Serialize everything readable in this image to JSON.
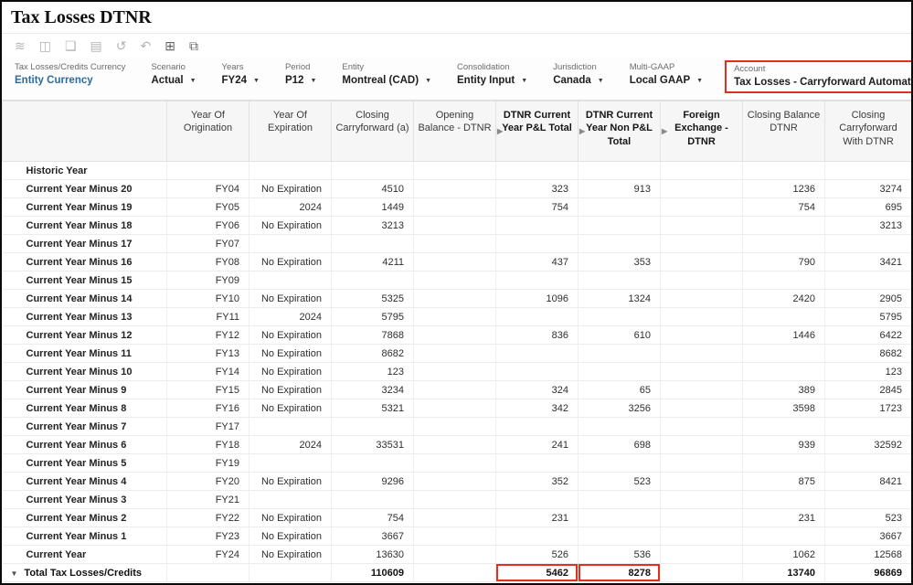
{
  "colors": {
    "accent_red": "#e0301e",
    "link_blue": "#2b6b9e"
  },
  "page": {
    "title": "Tax Losses DTNR"
  },
  "toolbar": {
    "icons": [
      {
        "name": "format-grid-icon",
        "glyph": "≋",
        "dim": true
      },
      {
        "name": "freeze-pane-icon",
        "glyph": "◫",
        "dim": true
      },
      {
        "name": "comment-icon",
        "glyph": "❑",
        "dim": true
      },
      {
        "name": "hierarchy-icon",
        "glyph": "▤",
        "dim": true
      },
      {
        "name": "history-icon",
        "glyph": "↺",
        "dim": true
      },
      {
        "name": "undo-icon",
        "glyph": "↶",
        "dim": true
      },
      {
        "name": "expand-grid-icon",
        "glyph": "⊞",
        "dim": false
      },
      {
        "name": "open-window-icon",
        "glyph": "⧉",
        "dim": false
      }
    ]
  },
  "pov": {
    "items": [
      {
        "label": "Tax Losses/Credits Currency",
        "value": "Entity Currency",
        "dropdown": false,
        "blue": true,
        "highlighted": false
      },
      {
        "label": "Scenario",
        "value": "Actual",
        "dropdown": true,
        "blue": false,
        "highlighted": false
      },
      {
        "label": "Years",
        "value": "FY24",
        "dropdown": true,
        "blue": false,
        "highlighted": false
      },
      {
        "label": "Period",
        "value": "P12",
        "dropdown": true,
        "blue": false,
        "highlighted": false
      },
      {
        "label": "Entity",
        "value": "Montreal (CAD)",
        "dropdown": true,
        "blue": false,
        "highlighted": false
      },
      {
        "label": "Consolidation",
        "value": "Entity Input",
        "dropdown": true,
        "blue": false,
        "highlighted": false
      },
      {
        "label": "Jurisdiction",
        "value": "Canada",
        "dropdown": true,
        "blue": false,
        "highlighted": false
      },
      {
        "label": "Multi-GAAP",
        "value": "Local GAAP",
        "dropdown": true,
        "blue": false,
        "highlighted": false
      },
      {
        "label": "Account",
        "value": "Tax Losses - Carryforward Automated",
        "dropdown": false,
        "blue": false,
        "highlighted": true
      }
    ]
  },
  "table": {
    "columns": [
      {
        "label": "",
        "bold": false,
        "arrow": false
      },
      {
        "label": "Year Of Origination",
        "bold": false,
        "arrow": false
      },
      {
        "label": "Year Of Expiration",
        "bold": false,
        "arrow": false
      },
      {
        "label": "Closing Carryforward (a)",
        "bold": false,
        "arrow": false
      },
      {
        "label": "Opening Balance - DTNR",
        "bold": false,
        "arrow": false
      },
      {
        "label": "DTNR Current Year P&L Total",
        "bold": true,
        "arrow": true
      },
      {
        "label": "DTNR Current Year Non P&L Total",
        "bold": true,
        "arrow": true
      },
      {
        "label": "Foreign Exchange - DTNR",
        "bold": true,
        "arrow": true
      },
      {
        "label": "Closing Balance DTNR",
        "bold": false,
        "arrow": false
      },
      {
        "label": "Closing Carryforward With DTNR",
        "bold": false,
        "arrow": false
      }
    ],
    "rows": [
      {
        "label": "Historic Year",
        "cells": [
          "",
          "",
          "",
          "",
          "",
          "",
          "",
          "",
          ""
        ]
      },
      {
        "label": "Current Year Minus 20",
        "cells": [
          "FY04",
          "No Expiration",
          "4510",
          "",
          "323",
          "913",
          "",
          "1236",
          "3274"
        ]
      },
      {
        "label": "Current Year Minus 19",
        "cells": [
          "FY05",
          "2024",
          "1449",
          "",
          "754",
          "",
          "",
          "754",
          "695"
        ]
      },
      {
        "label": "Current Year Minus 18",
        "cells": [
          "FY06",
          "No Expiration",
          "3213",
          "",
          "",
          "",
          "",
          "",
          "3213"
        ]
      },
      {
        "label": "Current Year Minus 17",
        "cells": [
          "FY07",
          "",
          "",
          "",
          "",
          "",
          "",
          "",
          ""
        ]
      },
      {
        "label": "Current Year Minus 16",
        "cells": [
          "FY08",
          "No Expiration",
          "4211",
          "",
          "437",
          "353",
          "",
          "790",
          "3421"
        ]
      },
      {
        "label": "Current Year Minus 15",
        "cells": [
          "FY09",
          "",
          "",
          "",
          "",
          "",
          "",
          "",
          ""
        ]
      },
      {
        "label": "Current Year Minus 14",
        "cells": [
          "FY10",
          "No Expiration",
          "5325",
          "",
          "1096",
          "1324",
          "",
          "2420",
          "2905"
        ]
      },
      {
        "label": "Current Year Minus 13",
        "cells": [
          "FY11",
          "2024",
          "5795",
          "",
          "",
          "",
          "",
          "",
          "5795"
        ]
      },
      {
        "label": "Current Year Minus 12",
        "cells": [
          "FY12",
          "No Expiration",
          "7868",
          "",
          "836",
          "610",
          "",
          "1446",
          "6422"
        ]
      },
      {
        "label": "Current Year Minus 11",
        "cells": [
          "FY13",
          "No Expiration",
          "8682",
          "",
          "",
          "",
          "",
          "",
          "8682"
        ]
      },
      {
        "label": "Current Year Minus 10",
        "cells": [
          "FY14",
          "No Expiration",
          "123",
          "",
          "",
          "",
          "",
          "",
          "123"
        ]
      },
      {
        "label": "Current Year Minus 9",
        "cells": [
          "FY15",
          "No Expiration",
          "3234",
          "",
          "324",
          "65",
          "",
          "389",
          "2845"
        ]
      },
      {
        "label": "Current Year Minus 8",
        "cells": [
          "FY16",
          "No Expiration",
          "5321",
          "",
          "342",
          "3256",
          "",
          "3598",
          "1723"
        ]
      },
      {
        "label": "Current Year Minus 7",
        "cells": [
          "FY17",
          "",
          "",
          "",
          "",
          "",
          "",
          "",
          ""
        ]
      },
      {
        "label": "Current Year Minus 6",
        "cells": [
          "FY18",
          "2024",
          "33531",
          "",
          "241",
          "698",
          "",
          "939",
          "32592"
        ]
      },
      {
        "label": "Current Year Minus 5",
        "cells": [
          "FY19",
          "",
          "",
          "",
          "",
          "",
          "",
          "",
          ""
        ]
      },
      {
        "label": "Current Year Minus 4",
        "cells": [
          "FY20",
          "No Expiration",
          "9296",
          "",
          "352",
          "523",
          "",
          "875",
          "8421"
        ]
      },
      {
        "label": "Current Year Minus 3",
        "cells": [
          "FY21",
          "",
          "",
          "",
          "",
          "",
          "",
          "",
          ""
        ]
      },
      {
        "label": "Current Year Minus 2",
        "cells": [
          "FY22",
          "No Expiration",
          "754",
          "",
          "231",
          "",
          "",
          "231",
          "523"
        ]
      },
      {
        "label": "Current Year Minus 1",
        "cells": [
          "FY23",
          "No Expiration",
          "3667",
          "",
          "",
          "",
          "",
          "",
          "3667"
        ]
      },
      {
        "label": "Current Year",
        "cells": [
          "FY24",
          "No Expiration",
          "13630",
          "",
          "526",
          "536",
          "",
          "1062",
          "12568"
        ]
      }
    ],
    "total_row": {
      "label": "Total Tax Losses/Credits",
      "collapse_icon": "▼",
      "cells": [
        "",
        "",
        "110609",
        "",
        "5462",
        "8278",
        "",
        "13740",
        "96869"
      ],
      "highlight_cells": [
        4,
        5
      ]
    }
  }
}
